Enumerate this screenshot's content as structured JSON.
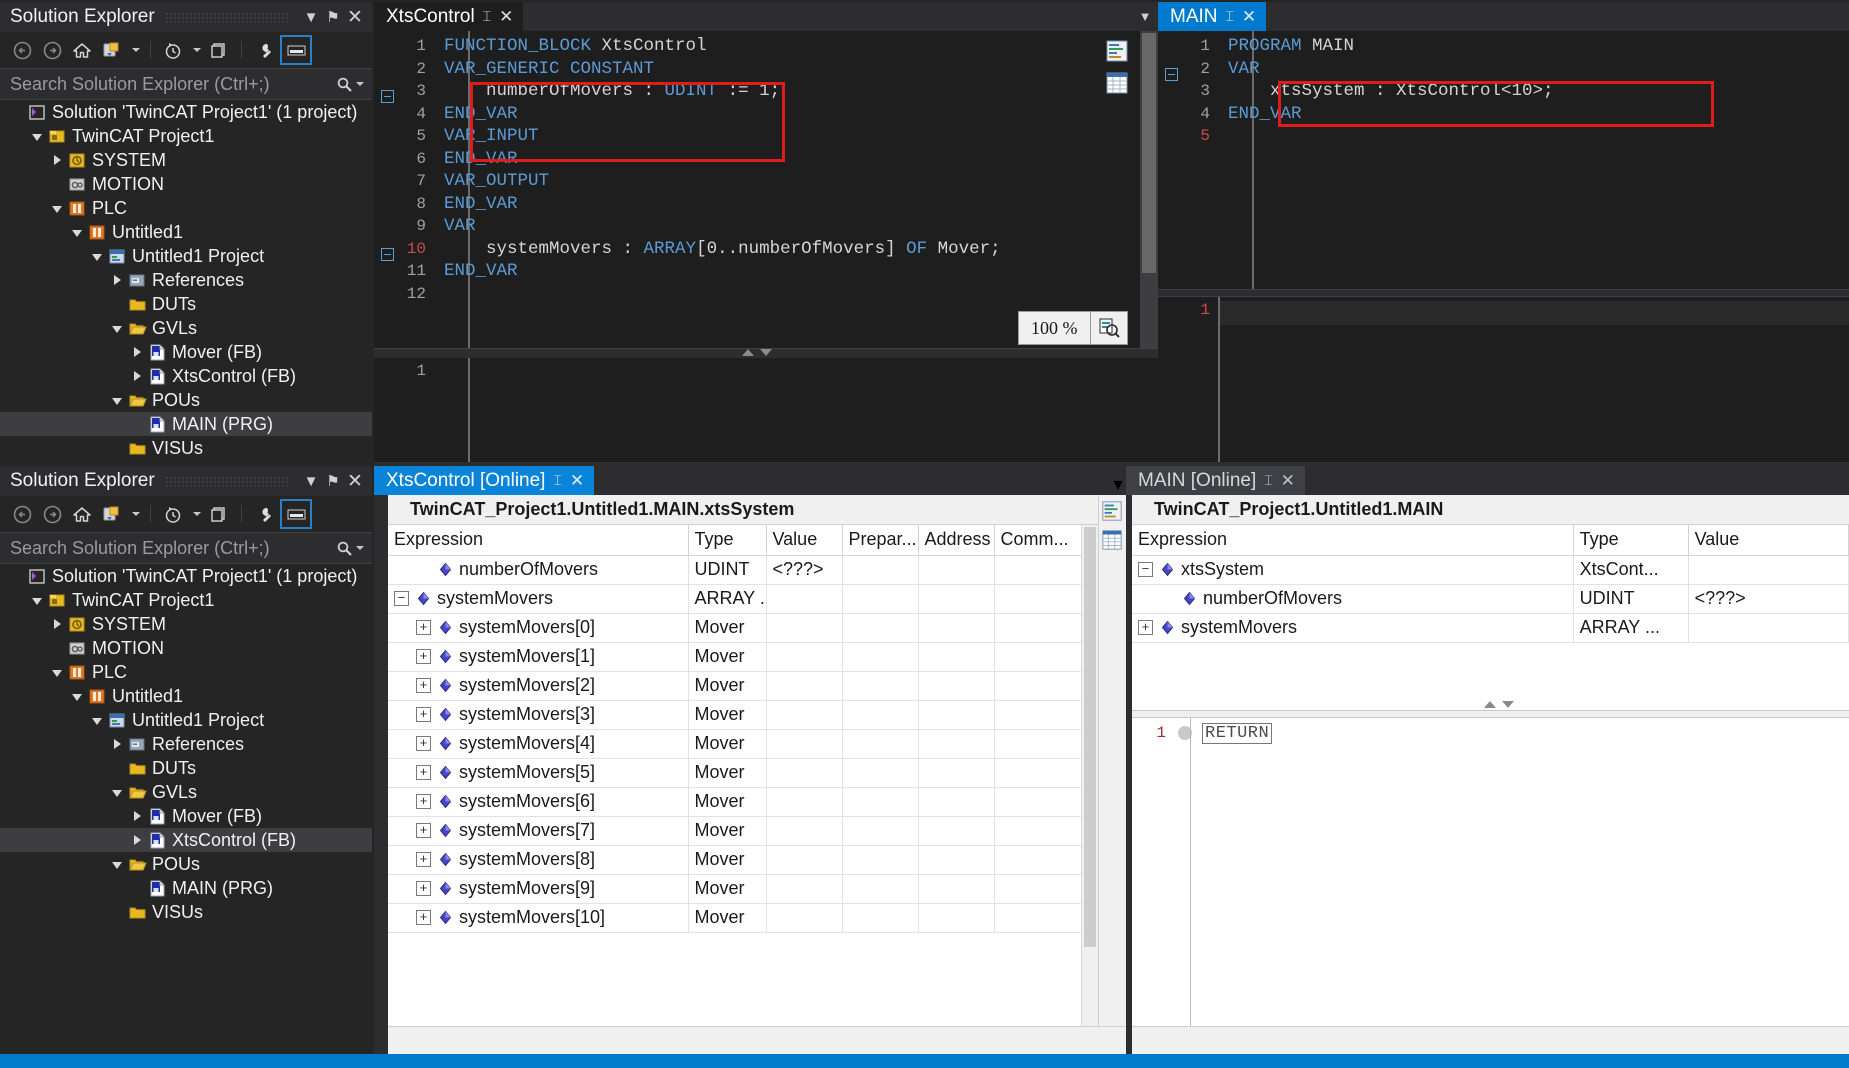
{
  "solution_explorer_top": {
    "title": "Solution Explorer",
    "search_placeholder": "Search Solution Explorer (Ctrl+;)",
    "toolbar": {
      "back": "back-arrow",
      "forward": "forward-arrow",
      "home": "home",
      "sync": "sync-with-active-document",
      "pending_changes": "pending-changes-filter",
      "show_all": "show-all-files",
      "properties": "properties",
      "preview": "preview-selected-items"
    },
    "window_buttons": {
      "dropdown": "▼",
      "pin": "⚑",
      "close": "✕"
    },
    "items": [
      {
        "label": "Solution 'TwinCAT Project1' (1 project)",
        "indent": 0,
        "twist": "none",
        "icon": "solution",
        "selected": false
      },
      {
        "label": "TwinCAT Project1",
        "indent": 1,
        "twist": "expanded",
        "icon": "tc-project",
        "selected": false
      },
      {
        "label": "SYSTEM",
        "indent": 2,
        "twist": "collapsed",
        "icon": "system",
        "selected": false
      },
      {
        "label": "MOTION",
        "indent": 2,
        "twist": "none",
        "icon": "motion",
        "selected": false
      },
      {
        "label": "PLC",
        "indent": 2,
        "twist": "expanded",
        "icon": "plc",
        "selected": false
      },
      {
        "label": "Untitled1",
        "indent": 3,
        "twist": "expanded",
        "icon": "plc",
        "selected": false
      },
      {
        "label": "Untitled1 Project",
        "indent": 4,
        "twist": "expanded",
        "icon": "plc-project",
        "selected": false
      },
      {
        "label": "References",
        "indent": 5,
        "twist": "collapsed",
        "icon": "references",
        "selected": false
      },
      {
        "label": "DUTs",
        "indent": 5,
        "twist": "none",
        "icon": "folder",
        "selected": false
      },
      {
        "label": "GVLs",
        "indent": 5,
        "twist": "expanded",
        "icon": "folder-open",
        "selected": false
      },
      {
        "label": "Mover (FB)",
        "indent": 6,
        "twist": "collapsed",
        "icon": "pou",
        "selected": false
      },
      {
        "label": "XtsControl (FB)",
        "indent": 6,
        "twist": "collapsed",
        "icon": "pou",
        "selected": false
      },
      {
        "label": "POUs",
        "indent": 5,
        "twist": "expanded",
        "icon": "folder-open",
        "selected": false
      },
      {
        "label": "MAIN (PRG)",
        "indent": 6,
        "twist": "none",
        "icon": "pou",
        "selected": true
      },
      {
        "label": "VISUs",
        "indent": 5,
        "twist": "none",
        "icon": "folder",
        "selected": false
      }
    ]
  },
  "solution_explorer_bottom": {
    "title": "Solution Explorer",
    "search_placeholder": "Search Solution Explorer (Ctrl+;)",
    "window_buttons": {
      "dropdown": "▼",
      "pin": "⚑",
      "close": "✕"
    },
    "items": [
      {
        "label": "Solution 'TwinCAT Project1' (1 project)",
        "indent": 0,
        "twist": "none",
        "icon": "solution",
        "selected": false
      },
      {
        "label": "TwinCAT Project1",
        "indent": 1,
        "twist": "expanded",
        "icon": "tc-project",
        "selected": false
      },
      {
        "label": "SYSTEM",
        "indent": 2,
        "twist": "collapsed",
        "icon": "system",
        "selected": false
      },
      {
        "label": "MOTION",
        "indent": 2,
        "twist": "none",
        "icon": "motion",
        "selected": false
      },
      {
        "label": "PLC",
        "indent": 2,
        "twist": "expanded",
        "icon": "plc",
        "selected": false
      },
      {
        "label": "Untitled1",
        "indent": 3,
        "twist": "expanded",
        "icon": "plc",
        "selected": false
      },
      {
        "label": "Untitled1 Project",
        "indent": 4,
        "twist": "expanded",
        "icon": "plc-project",
        "selected": false
      },
      {
        "label": "References",
        "indent": 5,
        "twist": "collapsed",
        "icon": "references",
        "selected": false
      },
      {
        "label": "DUTs",
        "indent": 5,
        "twist": "none",
        "icon": "folder",
        "selected": false
      },
      {
        "label": "GVLs",
        "indent": 5,
        "twist": "expanded",
        "icon": "folder-open",
        "selected": false
      },
      {
        "label": "Mover (FB)",
        "indent": 6,
        "twist": "collapsed",
        "icon": "pou",
        "selected": false
      },
      {
        "label": "XtsControl (FB)",
        "indent": 6,
        "twist": "collapsed",
        "icon": "pou",
        "selected": true
      },
      {
        "label": "POUs",
        "indent": 5,
        "twist": "expanded",
        "icon": "folder-open",
        "selected": false
      },
      {
        "label": "MAIN (PRG)",
        "indent": 6,
        "twist": "none",
        "icon": "pou",
        "selected": false
      },
      {
        "label": "VISUs",
        "indent": 5,
        "twist": "none",
        "icon": "folder",
        "selected": false
      }
    ]
  },
  "editor_xtscontrol": {
    "tab": {
      "label": "XtsControl",
      "pin": "⚖",
      "close": "✕"
    },
    "zoom_level": "100 %",
    "lines": [
      {
        "n": "1",
        "modified": false,
        "fold": false,
        "text": "FUNCTION_BLOCK XtsControl",
        "kw_end": 14
      },
      {
        "n": "2",
        "modified": false,
        "fold": true,
        "text": "VAR_GENERIC CONSTANT",
        "kw_end": 20
      },
      {
        "n": "3",
        "modified": false,
        "fold": false,
        "text": "    numberOfMovers : UDINT := 1;",
        "kw_end": 0
      },
      {
        "n": "4",
        "modified": false,
        "fold": false,
        "text": "END_VAR",
        "kw_end": 7
      },
      {
        "n": "5",
        "modified": false,
        "fold": false,
        "text": "VAR_INPUT",
        "kw_end": 9
      },
      {
        "n": "6",
        "modified": false,
        "fold": false,
        "text": "END_VAR",
        "kw_end": 7
      },
      {
        "n": "7",
        "modified": false,
        "fold": false,
        "text": "VAR_OUTPUT",
        "kw_end": 10
      },
      {
        "n": "8",
        "modified": false,
        "fold": false,
        "text": "END_VAR",
        "kw_end": 7
      },
      {
        "n": "9",
        "modified": false,
        "fold": true,
        "text": "VAR",
        "kw_end": 3
      },
      {
        "n": "10",
        "modified": true,
        "fold": false,
        "text": "    systemMovers : ARRAY[0..numberOfMovers] OF Mover;",
        "kw_end": 0
      },
      {
        "n": "11",
        "modified": false,
        "fold": false,
        "text": "END_VAR",
        "kw_end": 7
      },
      {
        "n": "12",
        "modified": false,
        "fold": false,
        "text": "",
        "kw_end": 0
      }
    ],
    "highlight_note": "red-rectangle-around-var-generic-constant-block"
  },
  "editor_main": {
    "tab": {
      "label": "MAIN",
      "pin": "⚖",
      "close": "✕"
    },
    "lines": [
      {
        "n": "1",
        "modified": false,
        "fold": false,
        "text": "PROGRAM MAIN",
        "kw_end": 7
      },
      {
        "n": "2",
        "modified": false,
        "fold": true,
        "text": "VAR",
        "kw_end": 3
      },
      {
        "n": "3",
        "modified": false,
        "fold": false,
        "text": "    xtsSystem : XtsControl<10>;",
        "kw_end": 0
      },
      {
        "n": "4",
        "modified": false,
        "fold": false,
        "text": "END_VAR",
        "kw_end": 7
      },
      {
        "n": "5",
        "modified": true,
        "fold": false,
        "text": "",
        "kw_end": 0
      }
    ],
    "impl_line_number": "1",
    "highlight_note": "red-rectangle-around-xtsSystem-declaration"
  },
  "online_xtscontrol": {
    "tab": {
      "label": "XtsControl [Online]",
      "pin": "⚖",
      "close": "✕"
    },
    "header_path": "TwinCAT_Project1.Untitled1.MAIN.xtsSystem",
    "columns": [
      "Expression",
      "Type",
      "Value",
      "Prepar...",
      "Address",
      "Comm..."
    ],
    "rows": [
      {
        "pm": "none",
        "indent": 1,
        "expression": "numberOfMovers",
        "type": "UDINT",
        "value": "<???>",
        "prepared": "",
        "address": "",
        "comment": ""
      },
      {
        "pm": "minus",
        "indent": 0,
        "expression": "systemMovers",
        "type": "ARRAY ...",
        "value": "",
        "prepared": "",
        "address": "",
        "comment": ""
      },
      {
        "pm": "plus",
        "indent": 1,
        "expression": "systemMovers[0]",
        "type": "Mover",
        "value": "",
        "prepared": "",
        "address": "",
        "comment": ""
      },
      {
        "pm": "plus",
        "indent": 1,
        "expression": "systemMovers[1]",
        "type": "Mover",
        "value": "",
        "prepared": "",
        "address": "",
        "comment": ""
      },
      {
        "pm": "plus",
        "indent": 1,
        "expression": "systemMovers[2]",
        "type": "Mover",
        "value": "",
        "prepared": "",
        "address": "",
        "comment": ""
      },
      {
        "pm": "plus",
        "indent": 1,
        "expression": "systemMovers[3]",
        "type": "Mover",
        "value": "",
        "prepared": "",
        "address": "",
        "comment": ""
      },
      {
        "pm": "plus",
        "indent": 1,
        "expression": "systemMovers[4]",
        "type": "Mover",
        "value": "",
        "prepared": "",
        "address": "",
        "comment": ""
      },
      {
        "pm": "plus",
        "indent": 1,
        "expression": "systemMovers[5]",
        "type": "Mover",
        "value": "",
        "prepared": "",
        "address": "",
        "comment": ""
      },
      {
        "pm": "plus",
        "indent": 1,
        "expression": "systemMovers[6]",
        "type": "Mover",
        "value": "",
        "prepared": "",
        "address": "",
        "comment": ""
      },
      {
        "pm": "plus",
        "indent": 1,
        "expression": "systemMovers[7]",
        "type": "Mover",
        "value": "",
        "prepared": "",
        "address": "",
        "comment": ""
      },
      {
        "pm": "plus",
        "indent": 1,
        "expression": "systemMovers[8]",
        "type": "Mover",
        "value": "",
        "prepared": "",
        "address": "",
        "comment": ""
      },
      {
        "pm": "plus",
        "indent": 1,
        "expression": "systemMovers[9]",
        "type": "Mover",
        "value": "",
        "prepared": "",
        "address": "",
        "comment": ""
      },
      {
        "pm": "plus",
        "indent": 1,
        "expression": "systemMovers[10]",
        "type": "Mover",
        "value": "",
        "prepared": "",
        "address": "",
        "comment": ""
      }
    ]
  },
  "online_main": {
    "tab": {
      "label": "MAIN [Online]",
      "pin": "⚖",
      "close": "✕"
    },
    "header_path": "TwinCAT_Project1.Untitled1.MAIN",
    "columns": [
      "Expression",
      "Type",
      "Value"
    ],
    "rows": [
      {
        "pm": "minus",
        "indent": 0,
        "expression": "xtsSystem",
        "type": "XtsCont...",
        "value": ""
      },
      {
        "pm": "none",
        "indent": 1,
        "expression": "numberOfMovers",
        "type": "UDINT",
        "value": "<???>"
      },
      {
        "pm": "plus",
        "indent": 0,
        "expression": "systemMovers",
        "type": "ARRAY ...",
        "value": ""
      }
    ],
    "impl": {
      "line_number": "1",
      "code": "RETURN"
    }
  },
  "colors": {
    "accent_blue": "#007acc",
    "tab_active_blue": "#0a84d8",
    "editor_bg": "#1e1e1e",
    "panel_bg": "#252526",
    "keyword_blue": "#5b9bd5",
    "highlight_red": "#e01b1b",
    "modified_line": "#d04a4a"
  }
}
